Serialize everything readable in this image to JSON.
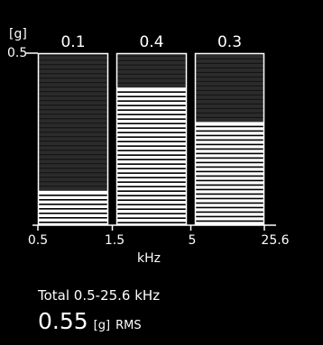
{
  "chart_data": {
    "type": "bar",
    "unit_label": "[g]",
    "ymax_label": "0.5",
    "ylim": [
      0,
      0.5
    ],
    "x_ticks": [
      "0.5",
      "1.5",
      "5",
      "25.6"
    ],
    "xlabel": "kHz",
    "bands": [
      {
        "range": "0.5-1.5",
        "value": 0.1,
        "value_label": "0.1"
      },
      {
        "range": "1.5-5",
        "value": 0.4,
        "value_label": "0.4"
      },
      {
        "range": "5-25.6",
        "value": 0.3,
        "value_label": "0.3"
      }
    ]
  },
  "total": {
    "label": "Total 0.5-25.6 kHz",
    "value": "0.55",
    "unit": "[g]",
    "measure": "RMS"
  },
  "colors": {
    "background": "#000000",
    "foreground": "#ffffff",
    "bar_empty": "#2b2b2b"
  }
}
